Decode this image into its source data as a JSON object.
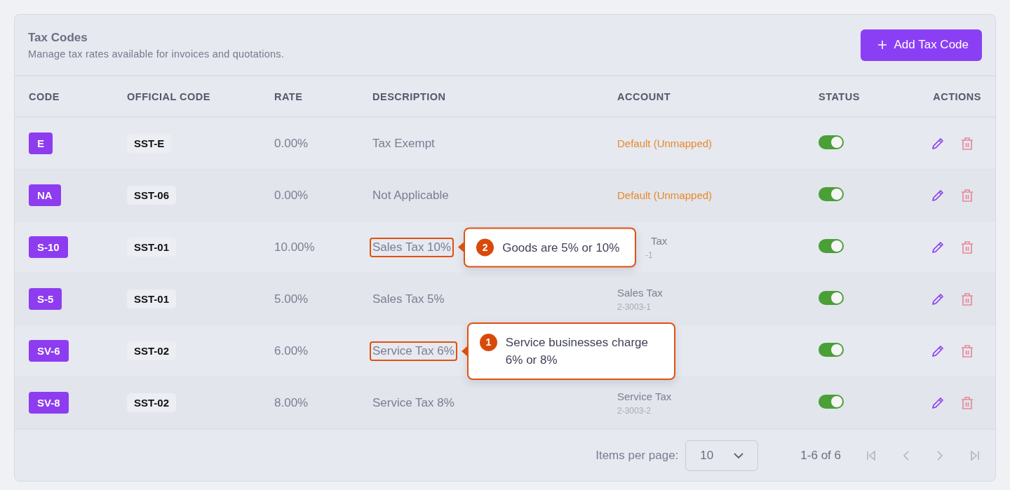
{
  "header": {
    "title": "Tax Codes",
    "subtitle": "Manage tax rates available for invoices and quotations.",
    "add_button": "Add Tax Code"
  },
  "table": {
    "columns": [
      "CODE",
      "OFFICIAL CODE",
      "RATE",
      "DESCRIPTION",
      "ACCOUNT",
      "STATUS",
      "ACTIONS"
    ],
    "rows": [
      {
        "code": "E",
        "official_code": "SST-E",
        "rate": "0.00%",
        "description": "Tax Exempt",
        "highlighted": false,
        "account": {
          "kind": "unmapped",
          "label": "Default (Unmapped)"
        },
        "on": true
      },
      {
        "code": "NA",
        "official_code": "SST-06",
        "rate": "0.00%",
        "description": "Not Applicable",
        "highlighted": false,
        "account": {
          "kind": "unmapped",
          "label": "Default (Unmapped)"
        },
        "on": true
      },
      {
        "code": "S-10",
        "official_code": "SST-01",
        "rate": "10.00%",
        "description": "Sales Tax 10%",
        "highlighted": true,
        "callout": {
          "number": "2",
          "text": "Goods are 5% or 10%"
        },
        "account": {
          "kind": "covered",
          "name": "Tax",
          "code": "-1"
        },
        "on": true
      },
      {
        "code": "S-5",
        "official_code": "SST-01",
        "rate": "5.00%",
        "description": "Sales Tax 5%",
        "highlighted": false,
        "account": {
          "kind": "mapped",
          "name": "Sales Tax",
          "code": "2-3003-1"
        },
        "on": true
      },
      {
        "code": "SV-6",
        "official_code": "SST-02",
        "rate": "6.00%",
        "description": "Service Tax 6%",
        "highlighted": true,
        "callout": {
          "number": "1",
          "text": "Service businesses charge 6% or 8%"
        },
        "on": true
      },
      {
        "code": "SV-8",
        "official_code": "SST-02",
        "rate": "8.00%",
        "description": "Service Tax 8%",
        "highlighted": false,
        "account": {
          "kind": "mapped",
          "name": "Service Tax",
          "code": "2-3003-2"
        },
        "on": true
      }
    ]
  },
  "pagination": {
    "items_per_page_label": "Items per page:",
    "page_size": "10",
    "range": "1-6 of 6"
  }
}
